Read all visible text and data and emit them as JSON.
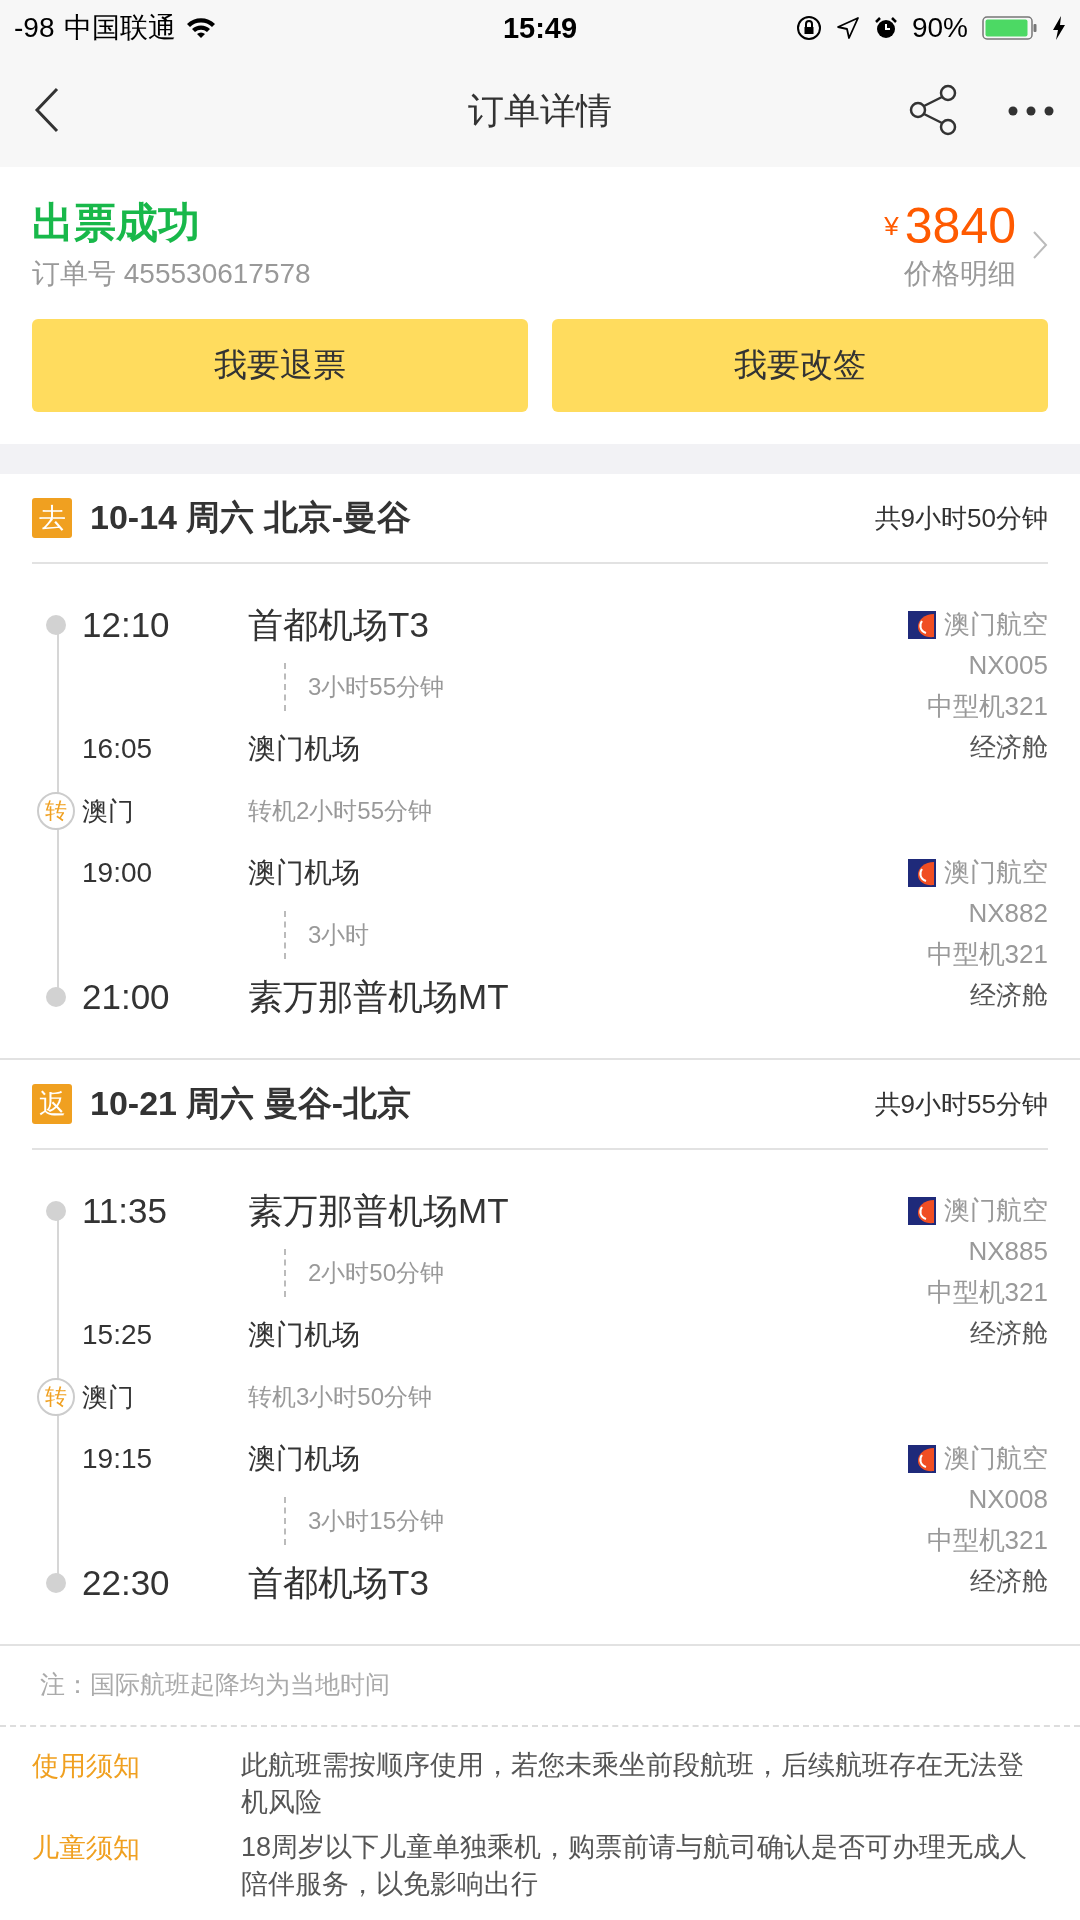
{
  "status_bar": {
    "signal": "-98",
    "carrier": "中国联通",
    "time": "15:49",
    "battery_text": "90%"
  },
  "nav": {
    "title": "订单详情"
  },
  "order": {
    "status": "出票成功",
    "order_no": "订单号 455530617578",
    "currency": "¥",
    "price": "3840",
    "price_link": "价格明细",
    "buttons": [
      "我要退票",
      "我要改签"
    ]
  },
  "trips": [
    {
      "badge": "去",
      "title": "10-14 周六 北京-曼谷",
      "total": "共9小时50分钟",
      "legs": [
        {
          "dep_time": "12:10",
          "dep_airport": "首都机场T3",
          "duration": "3小时55分钟",
          "arr_time": "16:05",
          "arr_airport": "澳门机场",
          "airline": "澳门航空",
          "flight_no": "NX005",
          "aircraft": "中型机321",
          "cabin": "经济舱"
        },
        {
          "dep_time": "19:00",
          "dep_airport": "澳门机场",
          "duration": "3小时",
          "arr_time": "21:00",
          "arr_airport": "素万那普机场MT",
          "airline": "澳门航空",
          "flight_no": "NX882",
          "aircraft": "中型机321",
          "cabin": "经济舱"
        }
      ],
      "transfer": {
        "mark": "转",
        "city": "澳门",
        "text": "转机2小时55分钟"
      }
    },
    {
      "badge": "返",
      "title": "10-21 周六 曼谷-北京",
      "total": "共9小时55分钟",
      "legs": [
        {
          "dep_time": "11:35",
          "dep_airport": "素万那普机场MT",
          "duration": "2小时50分钟",
          "arr_time": "15:25",
          "arr_airport": "澳门机场",
          "airline": "澳门航空",
          "flight_no": "NX885",
          "aircraft": "中型机321",
          "cabin": "经济舱"
        },
        {
          "dep_time": "19:15",
          "dep_airport": "澳门机场",
          "duration": "3小时15分钟",
          "arr_time": "22:30",
          "arr_airport": "首都机场T3",
          "airline": "澳门航空",
          "flight_no": "NX008",
          "aircraft": "中型机321",
          "cabin": "经济舱"
        }
      ],
      "transfer": {
        "mark": "转",
        "city": "澳门",
        "text": "转机3小时50分钟"
      }
    }
  ],
  "note": "注：国际航班起降均为当地时间",
  "notices": [
    {
      "label": "使用须知",
      "text": "此航班需按顺序使用，若您未乘坐前段航班，后续航班存在无法登机风险"
    },
    {
      "label": "儿童须知",
      "text": "18周岁以下儿童单独乘机，购票前请与航司确认是否可办理无成人陪伴服务，以免影响出行"
    }
  ]
}
